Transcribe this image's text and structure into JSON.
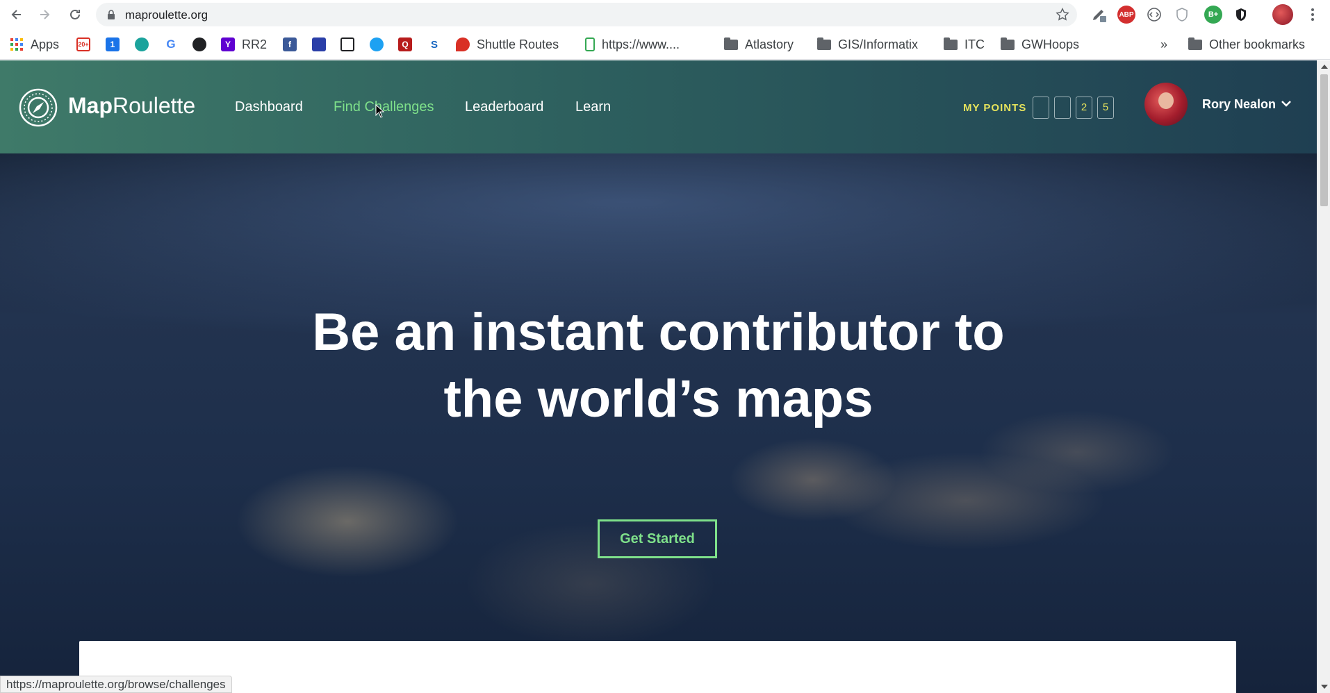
{
  "browser": {
    "url": "maproulette.org",
    "extensions": [
      "adblock-abp",
      "extension-badge-b"
    ],
    "bookmarks": [
      {
        "label": "Apps",
        "icon": "apps-grid-icon"
      },
      {
        "label": "",
        "icon": "gmail-icon",
        "badge": "20+"
      },
      {
        "label": "",
        "icon": "calendar-icon",
        "badge": "1"
      },
      {
        "label": "",
        "icon": "drop-icon"
      },
      {
        "label": "",
        "icon": "google-icon"
      },
      {
        "label": "",
        "icon": "bookmark-dark-icon"
      },
      {
        "label": "RR2",
        "icon": "yahoo-icon"
      },
      {
        "label": "",
        "icon": "facebook-icon"
      },
      {
        "label": "",
        "icon": "chart-icon"
      },
      {
        "label": "",
        "icon": "qr-icon"
      },
      {
        "label": "",
        "icon": "twitter-icon"
      },
      {
        "label": "",
        "icon": "q-icon"
      },
      {
        "label": "",
        "icon": "s-icon"
      },
      {
        "label": "Shuttle Routes",
        "icon": "map-pin-icon"
      },
      {
        "label": "https://www....",
        "icon": "phone-icon"
      },
      {
        "label": "Atlastory",
        "icon": "folder-icon"
      },
      {
        "label": "GIS/Informatix",
        "icon": "folder-icon"
      },
      {
        "label": "ITC",
        "icon": "folder-icon"
      },
      {
        "label": "GWHoops",
        "icon": "folder-icon"
      }
    ],
    "overflow": "»",
    "other_bookmarks": "Other bookmarks",
    "status_url": "https://maproulette.org/browse/challenges"
  },
  "site": {
    "brand_bold": "Map",
    "brand_rest": "Roulette",
    "nav": [
      {
        "label": "Dashboard",
        "active": false
      },
      {
        "label": "Find Challenges",
        "active": true
      },
      {
        "label": "Leaderboard",
        "active": false
      },
      {
        "label": "Learn",
        "active": false
      }
    ],
    "points_label": "MY POINTS",
    "points_digits": [
      "",
      "",
      "2",
      "5"
    ],
    "username": "Rory Nealon",
    "accent": "#7ee08a",
    "points_color": "#e6e35c"
  },
  "hero": {
    "title_line1": "Be an instant contributor to",
    "title_line2": "the world’s maps",
    "cta": "Get Started"
  }
}
